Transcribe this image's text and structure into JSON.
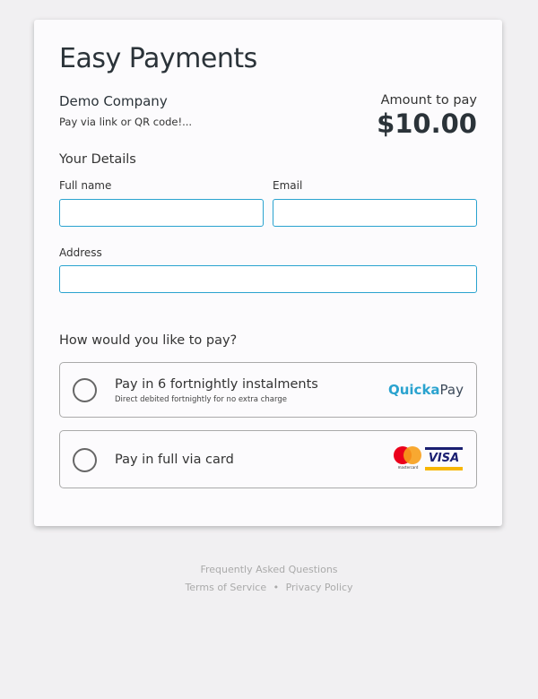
{
  "title": "Easy Payments",
  "company": "Demo Company",
  "description": "Pay via link or QR code!...",
  "amount_label": "Amount to pay",
  "amount": "$10.00",
  "details_heading": "Your Details",
  "fields": {
    "full_name": "Full name",
    "email": "Email",
    "address": "Address"
  },
  "pay_heading": "How would you like to pay?",
  "options": [
    {
      "title": "Pay in 6 fortnightly instalments",
      "subtitle": "Direct debited fortnightly for no extra charge",
      "brand_a": "Quicka",
      "brand_b": "Pay"
    },
    {
      "title": "Pay in full via card",
      "mastercard": "mastercard",
      "visa": "VISA"
    }
  ],
  "footer": {
    "faq": "Frequently Asked Questions",
    "terms": "Terms of Service",
    "sep": "•",
    "privacy": "Privacy Policy"
  }
}
